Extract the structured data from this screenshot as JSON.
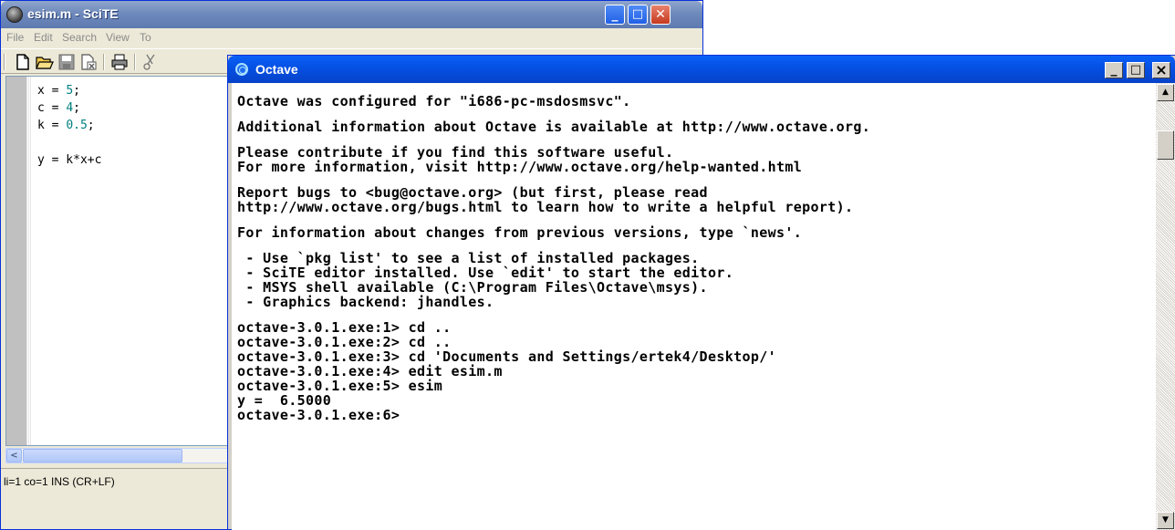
{
  "scite": {
    "title": "esim.m - SciTE",
    "menu": [
      "File",
      "Edit",
      "Search",
      "View",
      "To"
    ],
    "title_buttons": {
      "minimize": "_",
      "maximize": "□",
      "close": "✕"
    },
    "code": {
      "line1": {
        "text": "x = ",
        "num": "5",
        "tail": ";"
      },
      "line2": {
        "text": "c = ",
        "num": "4",
        "tail": ";"
      },
      "line3": {
        "text": "k = ",
        "num": "0.5",
        "tail": ";"
      },
      "line5": {
        "text": "y = k*x+c"
      }
    },
    "hscroll_left": "<",
    "status": "li=1 co=1 INS (CR+LF)",
    "colors": {
      "number": "#007f7f",
      "titlebar": "#7b93c2"
    }
  },
  "octave": {
    "title": "Octave",
    "title_buttons": {
      "minimize": "_",
      "maximize": "□",
      "close": "×"
    },
    "console_lines": [
      "Octave was configured for \"i686-pc-msdosmsvc\".",
      "Additional information about Octave is available at http://www.octave.org.",
      "Please contribute if you find this software useful.",
      "For more information, visit http://www.octave.org/help-wanted.html",
      "Report bugs to <bug@octave.org> (but first, please read",
      "http://www.octave.org/bugs.html to learn how to write a helpful report).",
      "For information about changes from previous versions, type `news'.",
      " - Use `pkg list' to see a list of installed packages.",
      " - SciTE editor installed. Use `edit' to start the editor.",
      " - MSYS shell available (C:\\Program Files\\Octave\\msys).",
      " - Graphics backend: jhandles.",
      "octave-3.0.1.exe:1> cd ..",
      "octave-3.0.1.exe:2> cd ..",
      "octave-3.0.1.exe:3> cd 'Documents and Settings/ertek4/Desktop/'",
      "octave-3.0.1.exe:4> edit esim.m",
      "octave-3.0.1.exe:5> esim",
      "y =  6.5000",
      "octave-3.0.1.exe:6>"
    ],
    "scroll_up": "▲",
    "scroll_down": "▼",
    "colors": {
      "titlebar": "#0550e3",
      "console_bg": "#ffffff"
    }
  }
}
